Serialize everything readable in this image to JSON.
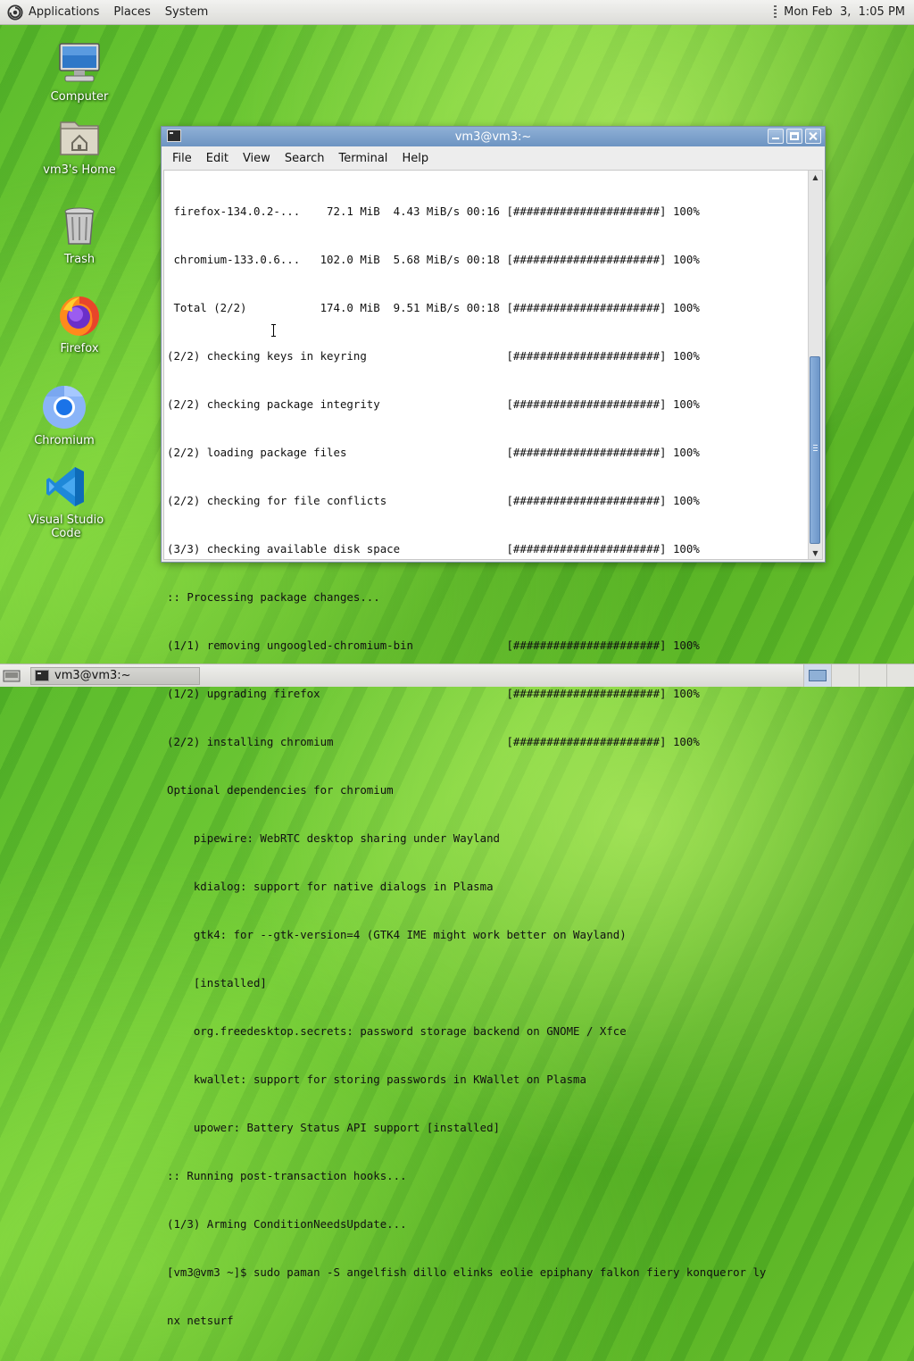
{
  "top_panel": {
    "menus": [
      "Applications",
      "Places",
      "System"
    ],
    "clock": "Mon Feb  3,  1:05 PM"
  },
  "desktop_icons": [
    {
      "label": "Computer",
      "icon": "computer-icon"
    },
    {
      "label": "vm3's Home",
      "icon": "home-folder-icon"
    },
    {
      "label": "Trash",
      "icon": "trash-icon"
    },
    {
      "label": "Firefox",
      "icon": "firefox-icon"
    },
    {
      "label": "Chromium",
      "icon": "chromium-icon"
    },
    {
      "label": "Visual Studio Code",
      "icon": "vscode-icon"
    }
  ],
  "window": {
    "title": "vm3@vm3:~",
    "menu": [
      "File",
      "Edit",
      "View",
      "Search",
      "Terminal",
      "Help"
    ],
    "terminal_lines": [
      " firefox-134.0.2-...    72.1 MiB  4.43 MiB/s 00:16 [######################] 100%",
      " chromium-133.0.6...   102.0 MiB  5.68 MiB/s 00:18 [######################] 100%",
      " Total (2/2)           174.0 MiB  9.51 MiB/s 00:18 [######################] 100%",
      "(2/2) checking keys in keyring                     [######################] 100%",
      "(2/2) checking package integrity                   [######################] 100%",
      "(2/2) loading package files                        [######################] 100%",
      "(2/2) checking for file conflicts                  [######################] 100%",
      "(3/3) checking available disk space                [######################] 100%",
      ":: Processing package changes...",
      "(1/1) removing ungoogled-chromium-bin              [######################] 100%",
      "(1/2) upgrading firefox                            [######################] 100%",
      "(2/2) installing chromium                          [######################] 100%",
      "Optional dependencies for chromium",
      "    pipewire: WebRTC desktop sharing under Wayland",
      "    kdialog: support for native dialogs in Plasma",
      "    gtk4: for --gtk-version=4 (GTK4 IME might work better on Wayland)",
      "    [installed]",
      "    org.freedesktop.secrets: password storage backend on GNOME / Xfce",
      "    kwallet: support for storing passwords in KWallet on Plasma",
      "    upower: Battery Status API support [installed]",
      ":: Running post-transaction hooks...",
      "(1/3) Arming ConditionNeedsUpdate...",
      "[vm3@vm3 ~]$ sudo paman -S angelfish dillo elinks eolie epiphany falkon fiery konqueror ly",
      "nx netsurf"
    ]
  },
  "taskbar": {
    "task_label": "vm3@vm3:~"
  },
  "colors": {
    "titlebar": "#7ea1cb",
    "desktop": "#5cb82a"
  }
}
